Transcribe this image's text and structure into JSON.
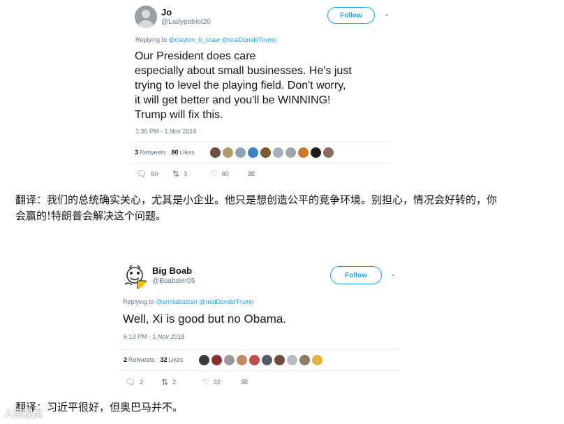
{
  "tweets": [
    {
      "name": "Jo",
      "handle": "@Ladypatriot20",
      "follow_label": "Follow",
      "replying_prefix": "Replying to ",
      "replying_to": "@clayton_b_shaw @realDonaldTrump",
      "text": "Our President does care\nespecially about small businesses.  He's just\ntrying to level the playing field.  Don't worry,\nit will get better and you'll be WINNING!\nTrump will fix this.",
      "timestamp": "1:35 PM - 1 Nov 2018",
      "retweets_count": "3",
      "retweets_label": "Retweets",
      "likes_count": "80",
      "likes_label": "Likes",
      "replies": "60",
      "retweets_action": "3",
      "likes_action": "60"
    },
    {
      "name": "Big Boab",
      "handle": "@Boabster05",
      "follow_label": "Follow",
      "replying_prefix": "Replying to ",
      "replying_to": "@emiliabalzan @realDonaldTrump",
      "text": "Well, Xi is good but no Obama.",
      "timestamp": "6:13 PM - 1 Nov 2018",
      "retweets_count": "2",
      "retweets_label": "Retweets",
      "likes_count": "32",
      "likes_label": "Likes",
      "replies": "2",
      "retweets_action": "2",
      "likes_action": "32"
    }
  ],
  "translations": {
    "first": "翻译：我们的总统确实关心，尤其是小企业。他只是想创造公平的竞争环境。别担心，情况会好转的，你会赢的!特朗普会解决这个问题。",
    "second": "翻译：习近平很好，但奥巴马并不。"
  },
  "watermark": "人民视觉",
  "icons": {
    "reply": "reply-icon",
    "retweet": "retweet-icon",
    "like": "heart-icon",
    "dm": "envelope-icon",
    "more": "chevron-down-icon"
  },
  "colors": {
    "accent": "#1da1f2",
    "muted": "#657786",
    "text": "#14171a"
  }
}
